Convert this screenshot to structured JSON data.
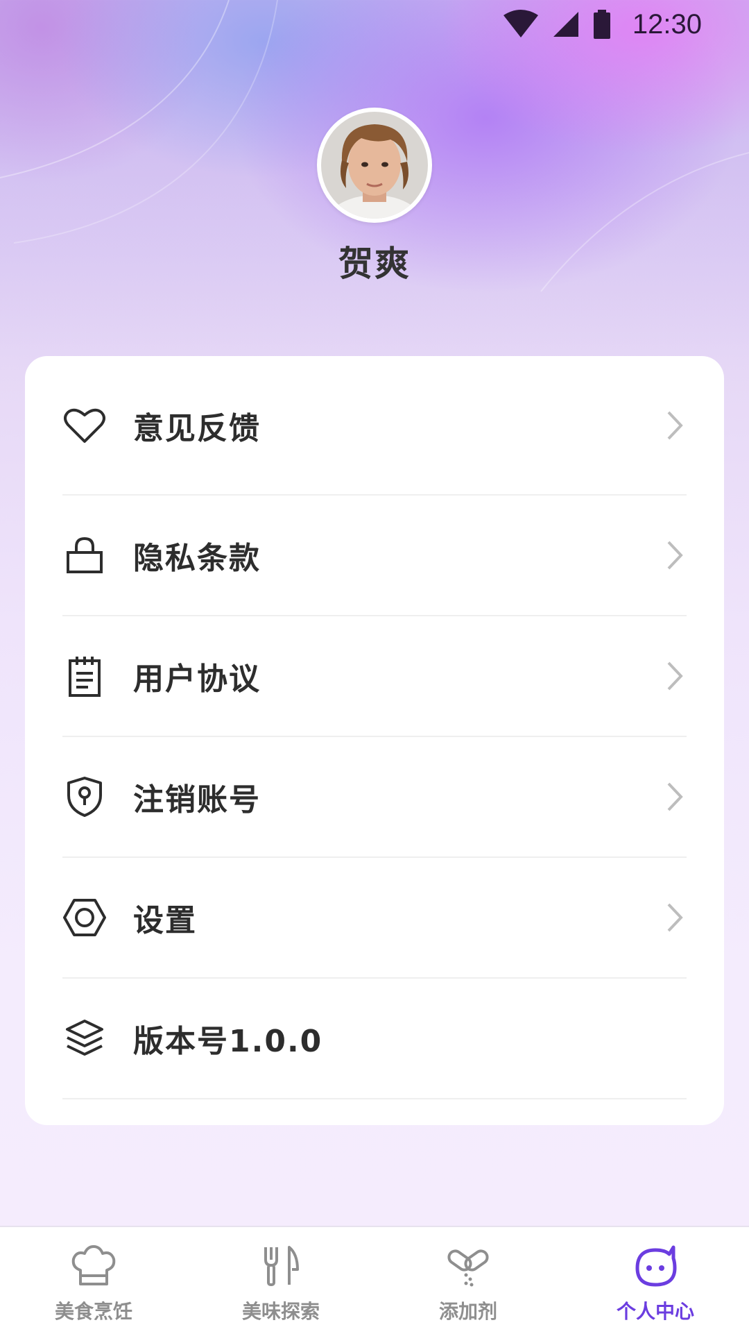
{
  "status_bar": {
    "time": "12:30"
  },
  "profile": {
    "name": "贺爽"
  },
  "menu": {
    "items": [
      {
        "label": "意见反馈",
        "icon": "heart-icon",
        "has_arrow": true
      },
      {
        "label": "隐私条款",
        "icon": "lock-icon",
        "has_arrow": true
      },
      {
        "label": "用户协议",
        "icon": "notepad-icon",
        "has_arrow": true
      },
      {
        "label": "注销账号",
        "icon": "shield-key-icon",
        "has_arrow": true
      },
      {
        "label": "设置",
        "icon": "hexagon-settings-icon",
        "has_arrow": true
      },
      {
        "label": "版本号1.0.0",
        "icon": "layers-icon",
        "has_arrow": false
      }
    ]
  },
  "bottom_nav": {
    "items": [
      {
        "label": "美食烹饪",
        "icon": "chef-hat-icon",
        "active": false
      },
      {
        "label": "美味探索",
        "icon": "fork-knife-icon",
        "active": false
      },
      {
        "label": "添加剂",
        "icon": "capsule-icon",
        "active": false
      },
      {
        "label": "个人中心",
        "icon": "smiley-face-icon",
        "active": true
      }
    ]
  },
  "colors": {
    "accent": "#6b3de0",
    "inactive": "#8e8e8e",
    "text": "#2d2d2d"
  }
}
